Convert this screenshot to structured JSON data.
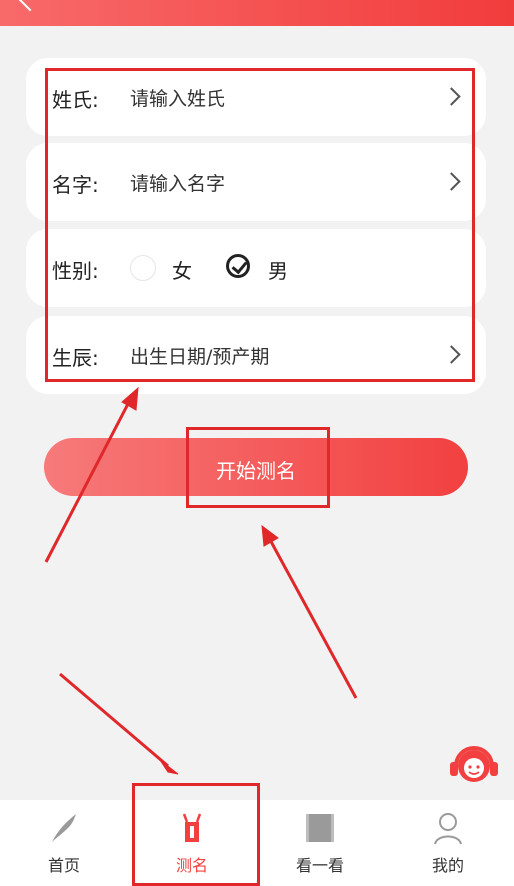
{
  "form": {
    "surname_label": "姓氏:",
    "surname_placeholder": "请输入姓氏",
    "name_label": "名字:",
    "name_placeholder": "请输入名字",
    "gender_label": "性别:",
    "gender_female": "女",
    "gender_male": "男",
    "gender_selected": "男",
    "birth_label": "生辰:",
    "birth_placeholder": "出生日期/预产期"
  },
  "start_button": "开始测名",
  "tabs": [
    {
      "label": "首页",
      "icon": "brush-icon",
      "active": false
    },
    {
      "label": "测名",
      "icon": "name-test-icon",
      "active": true
    },
    {
      "label": "看一看",
      "icon": "scroll-icon",
      "active": false
    },
    {
      "label": "我的",
      "icon": "user-icon",
      "active": false
    }
  ],
  "colors": {
    "accent": "#f24040",
    "annotation": "#e0282a",
    "active_tab": "#f24040"
  }
}
